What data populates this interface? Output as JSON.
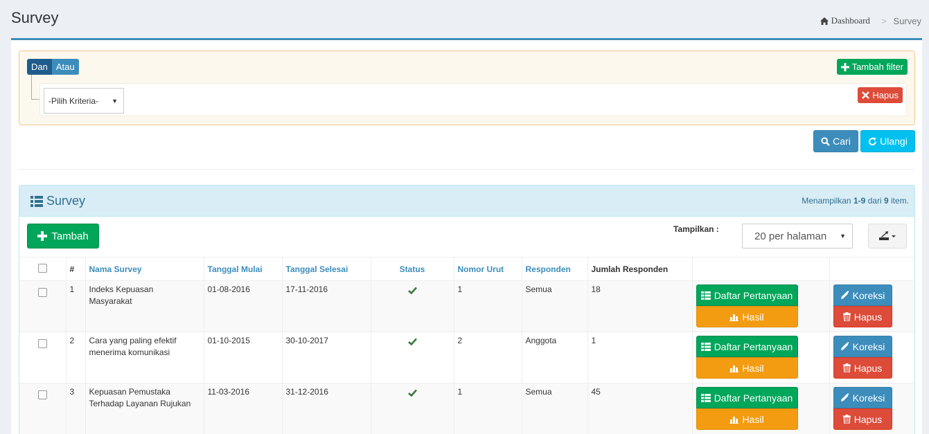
{
  "page": {
    "title": "Survey"
  },
  "breadcrumb": {
    "home": "Dashboard",
    "separator": ">",
    "current": "Survey"
  },
  "filter": {
    "logic_and": "Dan",
    "logic_or": "Atau",
    "add_filter_label": "Tambah filter",
    "criteria_value": "-Pilih Kriteria-",
    "delete_label": "Hapus"
  },
  "actions": {
    "search_label": "Cari",
    "reset_label": "Ulangi"
  },
  "list": {
    "title": "Survey",
    "summary_prefix": "Menampilkan ",
    "summary_range": "1-9",
    "summary_mid": " dari ",
    "summary_total": "9",
    "summary_suffix": " item.",
    "add_label": "Tambah",
    "show_label": "Tampilkan :",
    "per_page_value": "20 per halaman"
  },
  "table": {
    "columns": {
      "no": "#",
      "name": "Nama Survey",
      "start": "Tanggal Mulai",
      "end": "Tanggal Selesai",
      "status": "Status",
      "order": "Nomor Urut",
      "respondent": "Responden",
      "respondent_count": "Jumlah Responden"
    },
    "button_labels": {
      "questions": "Daftar Pertanyaan",
      "results": "Hasil",
      "edit": "Koreksi",
      "delete": "Hapus"
    },
    "rows": [
      {
        "no": "1",
        "name_line1": "Indeks Kepuasan",
        "name_line2": "Masyarakat",
        "start": "01-08-2016",
        "end": "17-11-2016",
        "status": "active",
        "order": "1",
        "respondent": "Semua",
        "count": "18"
      },
      {
        "no": "2",
        "name_line1": "Cara yang paling efektif",
        "name_line2": "menerima komunikasi",
        "start": "01-10-2015",
        "end": "30-10-2017",
        "status": "active",
        "order": "2",
        "respondent": "Anggota",
        "count": "1"
      },
      {
        "no": "3",
        "name_line1": "Kepuasan Pemustaka",
        "name_line2": "Terhadap Layanan Rujukan",
        "start": "11-03-2016",
        "end": "31-12-2016",
        "status": "active",
        "order": "1",
        "respondent": "Semua",
        "count": "45"
      }
    ]
  },
  "colors": {
    "primary": "#3c8dbc",
    "success": "#00a65a",
    "warning": "#f39c12",
    "danger": "#dd4b39",
    "info": "#00c0ef"
  },
  "icons": [
    "home-icon",
    "plus-icon",
    "times-icon",
    "search-icon",
    "refresh-icon",
    "list-icon",
    "export-icon",
    "check-icon",
    "table-icon",
    "bar-chart-icon",
    "pencil-icon",
    "trash-icon"
  ]
}
